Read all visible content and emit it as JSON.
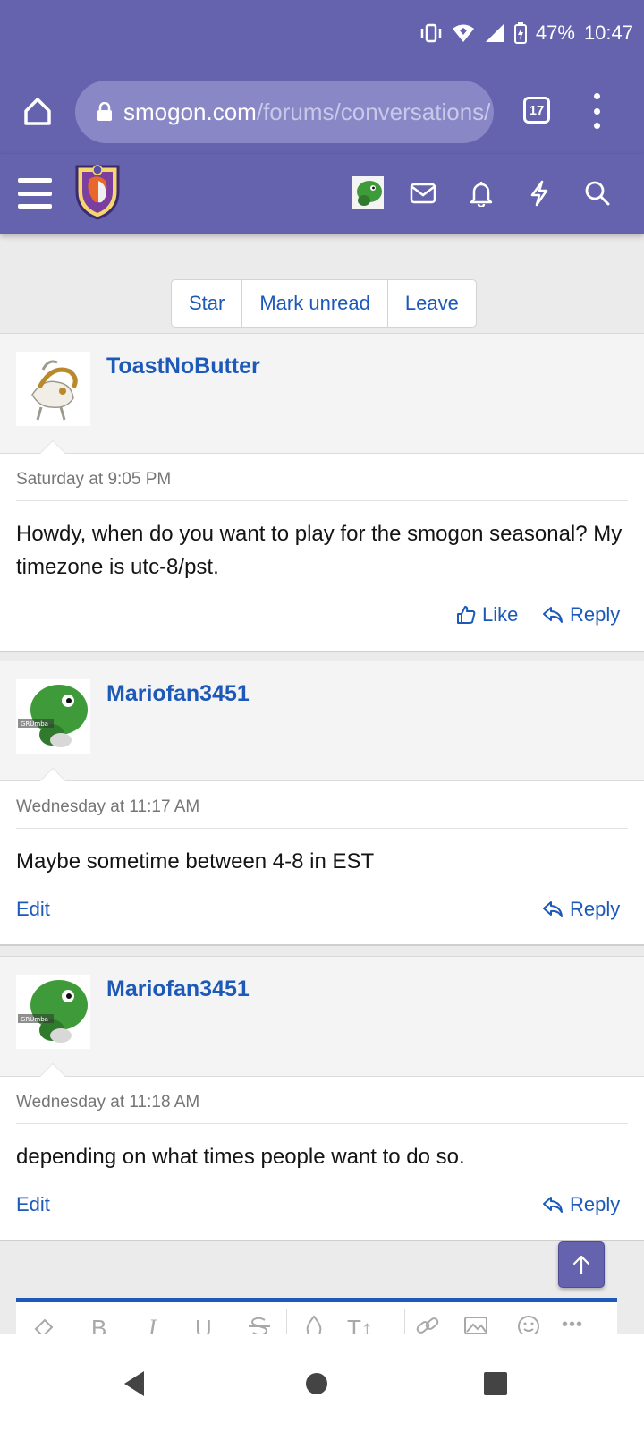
{
  "status_bar": {
    "battery": "47%",
    "time": "10:47",
    "icons": [
      "vibrate-icon",
      "wifi-icon",
      "signal-icon",
      "battery-charging-icon"
    ]
  },
  "browser": {
    "url_domain": "smogon.com",
    "url_path": "/forums/conversations/",
    "tab_count": "17",
    "icons": [
      "home-icon",
      "lock-icon",
      "tabs-icon",
      "more-vert-icon"
    ]
  },
  "site_nav": {
    "icons": [
      "hamburger-menu-icon",
      "site-logo",
      "user-avatar",
      "envelope-icon",
      "bell-icon",
      "lightning-icon",
      "search-icon"
    ]
  },
  "conversation_actions": [
    "Star",
    "Mark unread",
    "Leave"
  ],
  "messages": [
    {
      "user": "ToastNoButter",
      "time": "Saturday at 9:05 PM",
      "text": "Howdy, when do you want to play for the smogon seasonal? My timezone is utc-8/pst.",
      "like_label": "Like",
      "reply_label": "Reply"
    },
    {
      "user": "Mariofan3451",
      "time": "Wednesday at 11:17 AM",
      "text": "Maybe sometime between 4-8 in EST",
      "edit_label": "Edit",
      "reply_label": "Reply",
      "avatar_caption": "GRUmba"
    },
    {
      "user": "Mariofan3451",
      "time": "Wednesday at 11:18 AM",
      "text": "depending on what times people want to do so.",
      "edit_label": "Edit",
      "reply_label": "Reply",
      "avatar_caption": "GRUmba"
    }
  ],
  "editor_toolbar": {
    "bold": "B",
    "italic": "I",
    "underline": "U",
    "text_size": "T↕",
    "more": "•••"
  },
  "colors": {
    "header": "#6563ad",
    "link": "#1d59b8",
    "page_bg": "#ebebeb"
  }
}
